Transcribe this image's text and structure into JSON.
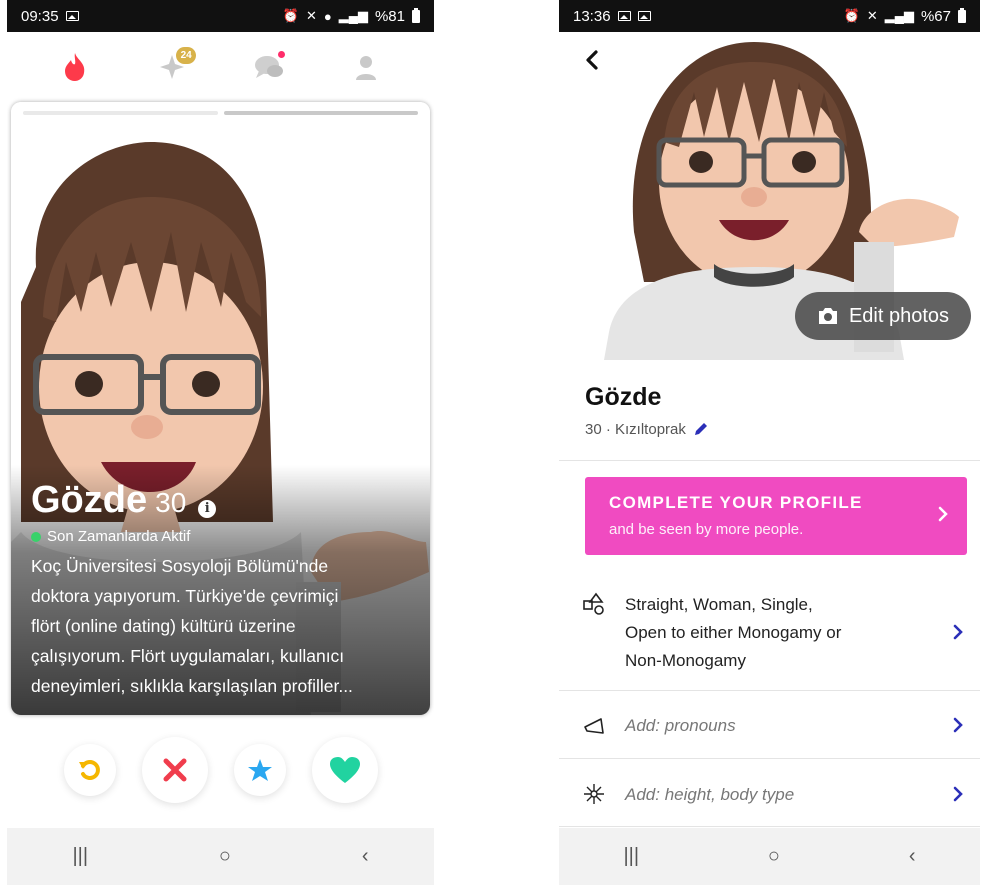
{
  "left": {
    "status": {
      "time": "09:35",
      "battery": "%81"
    },
    "nav": {
      "likes_badge": "24"
    },
    "card": {
      "name": "Gözde",
      "age": "30",
      "active_status": "Son Zamanlarda Aktif",
      "bio_lines": [
        "Koç Üniversitesi Sosyoloji Bölümü'nde",
        "doktora yapıyorum. Türkiye'de çevrimiçi",
        "flört (online dating) kültürü üzerine",
        "çalışıyorum. Flört uygulamaları, kullanıcı",
        "deneyimleri, sıklıkla karşılaşılan profiller..."
      ]
    },
    "colors": {
      "flame": "#fd3a4a",
      "rewind": "#f5b700",
      "nope": "#f03d4d",
      "super_like": "#2aa7f0",
      "like": "#21d3a0"
    }
  },
  "right": {
    "status": {
      "time": "13:36",
      "battery": "%67"
    },
    "edit_photos_label": "Edit photos",
    "name": "Gözde",
    "subtitle": "30 · Kızıltoprak",
    "cta": {
      "title": "COMPLETE YOUR PROFILE",
      "subtitle": "and be seen by more people."
    },
    "rows": [
      {
        "icon": "shapes-icon",
        "text_lines": [
          "Straight, Woman, Single,",
          "Open to either Monogamy or",
          "Non-Monogamy"
        ]
      },
      {
        "icon": "megaphone-icon",
        "text": "Add: pronouns"
      },
      {
        "icon": "sparkle-icon",
        "text": "Add: height, body type"
      }
    ],
    "colors": {
      "cta": "#f04bc1",
      "accent": "#2b2fb8"
    }
  }
}
